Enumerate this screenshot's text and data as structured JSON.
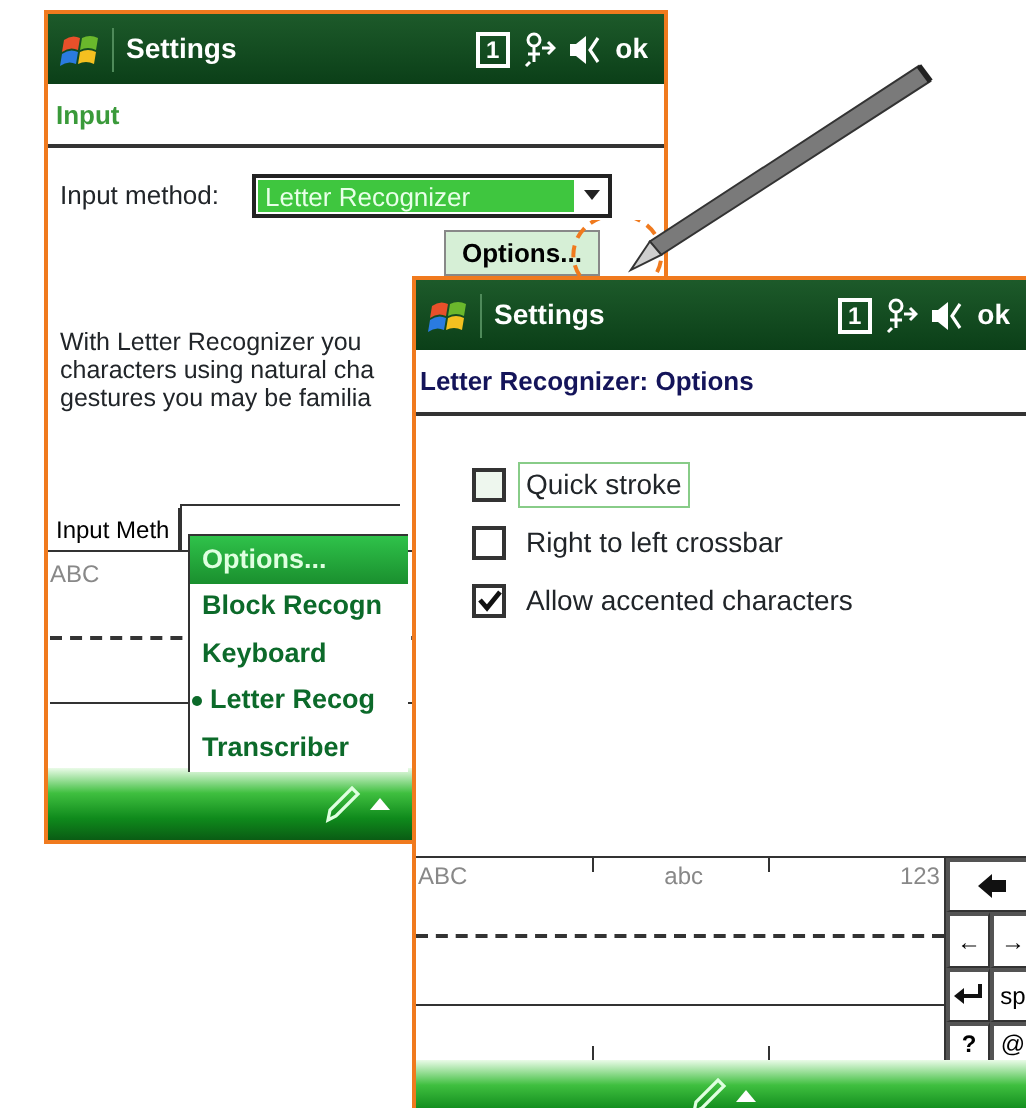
{
  "back_window": {
    "title": "Settings",
    "indicator": "1",
    "ok": "ok",
    "header": "Input",
    "input_method_label": "Input method:",
    "input_method_value": "Letter Recognizer",
    "options_button": "Options...",
    "description": [
      "With Letter Recognizer you",
      "characters using natural cha",
      "gestures you may be familia"
    ],
    "tabs": [
      "Input Meth"
    ],
    "writing_area_label": "ABC",
    "menu": [
      {
        "label": "Options...",
        "selected": true,
        "current": false
      },
      {
        "label": "Block Recogn",
        "selected": false,
        "current": false
      },
      {
        "label": "Keyboard",
        "selected": false,
        "current": false
      },
      {
        "label": "Letter Recog",
        "selected": false,
        "current": true
      },
      {
        "label": "Transcriber",
        "selected": false,
        "current": false
      }
    ]
  },
  "front_window": {
    "title": "Settings",
    "indicator": "1",
    "ok": "ok",
    "header": "Letter Recognizer: Options",
    "options": [
      {
        "label": "Quick stroke",
        "checked": false,
        "focused": true
      },
      {
        "label": "Right to left crossbar",
        "checked": false,
        "focused": false
      },
      {
        "label": "Allow accented characters",
        "checked": true,
        "focused": false
      }
    ],
    "zones": [
      "ABC",
      "abc",
      "123"
    ],
    "keys": [
      "←",
      "→",
      "sp",
      "?",
      "@"
    ]
  }
}
